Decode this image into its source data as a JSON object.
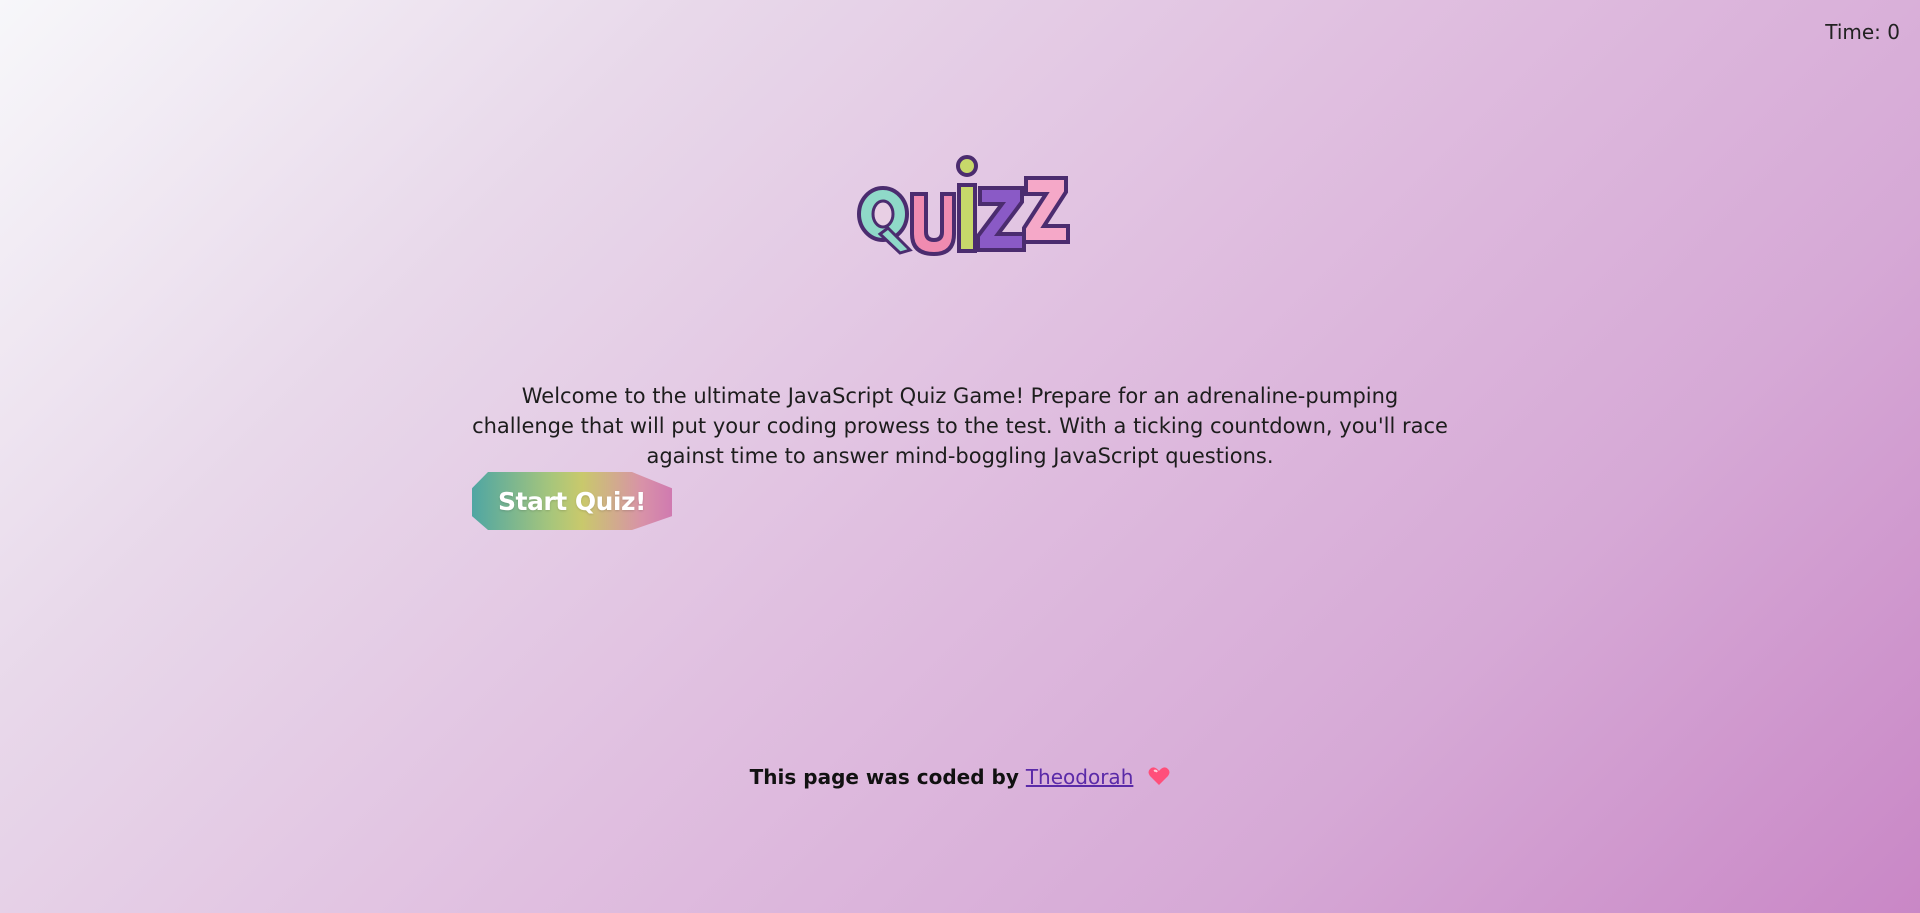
{
  "timer": {
    "label": "Time:",
    "value": "0"
  },
  "logo": {
    "text": "Quizz",
    "colors": [
      "#8fd9c8",
      "#f08bb0",
      "#c7d86a",
      "#8a5ac6",
      "#f5a8c8"
    ]
  },
  "intro": {
    "text": "Welcome to the ultimate JavaScript Quiz Game! Prepare for an adrenaline-pumping challenge that will put your coding prowess to the test. With a ticking countdown, you'll race against time to answer mind-boggling JavaScript questions."
  },
  "start": {
    "label": "Start Quiz!"
  },
  "footer": {
    "prefix": "This page was coded by",
    "author": "Theodorah",
    "icon": "heart-icon"
  }
}
